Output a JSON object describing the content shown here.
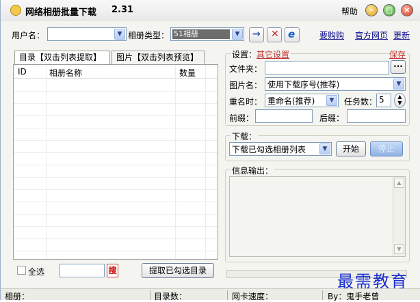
{
  "titlebar": {
    "app_title": "网络相册批量下载",
    "version": "2.31",
    "help_label": "帮助"
  },
  "toolbar": {
    "username_label": "用户名：",
    "username_value": "",
    "album_type_label": "相册类型：",
    "album_type_value": "51相册",
    "links": {
      "buy": "要购购",
      "official": "官方网页",
      "update": "更新"
    }
  },
  "tabs": [
    {
      "label": "目录【双击列表提取】"
    },
    {
      "label": "图片【双击列表预览】"
    }
  ],
  "album_table": {
    "columns": [
      "ID",
      "相册名称",
      "数量"
    ],
    "rows": []
  },
  "bottom_left": {
    "select_all_label": "全选",
    "search_value": "",
    "search_icon_text": "搜",
    "extract_button": "提取已勾选目录"
  },
  "settings": {
    "title": "设置：",
    "other_settings_link": "其它设置",
    "save_link": "保存",
    "folder_label": "文件夹：",
    "folder_value": "",
    "browse_label": "···",
    "picname_label": "图片名：",
    "picname_value": "使用下载序号(推荐)",
    "rename_label": "重名时：",
    "rename_value": "重命名(推荐)",
    "tasks_label": "任务数：",
    "tasks_value": "5",
    "prefix_label": "前缀：",
    "prefix_value": "",
    "suffix_label": "后缀：",
    "suffix_value": ""
  },
  "download": {
    "title": "下载：",
    "mode_value": "下载已勾选相册列表",
    "start_button": "开始",
    "stop_button": "停止"
  },
  "output": {
    "title": "信息输出：",
    "text": ""
  },
  "statusbar": {
    "album": "相册：",
    "dir_count": "目录数：",
    "net_speed": "网卡速度：",
    "by": "By：鬼手老曾"
  },
  "watermark": "最需教育",
  "colors": {
    "accent_link": "#0a0a8a",
    "red_link": "#c0302a",
    "watermark": "#1b2fd1",
    "start_btn_highlight": "#9dbbe8"
  }
}
